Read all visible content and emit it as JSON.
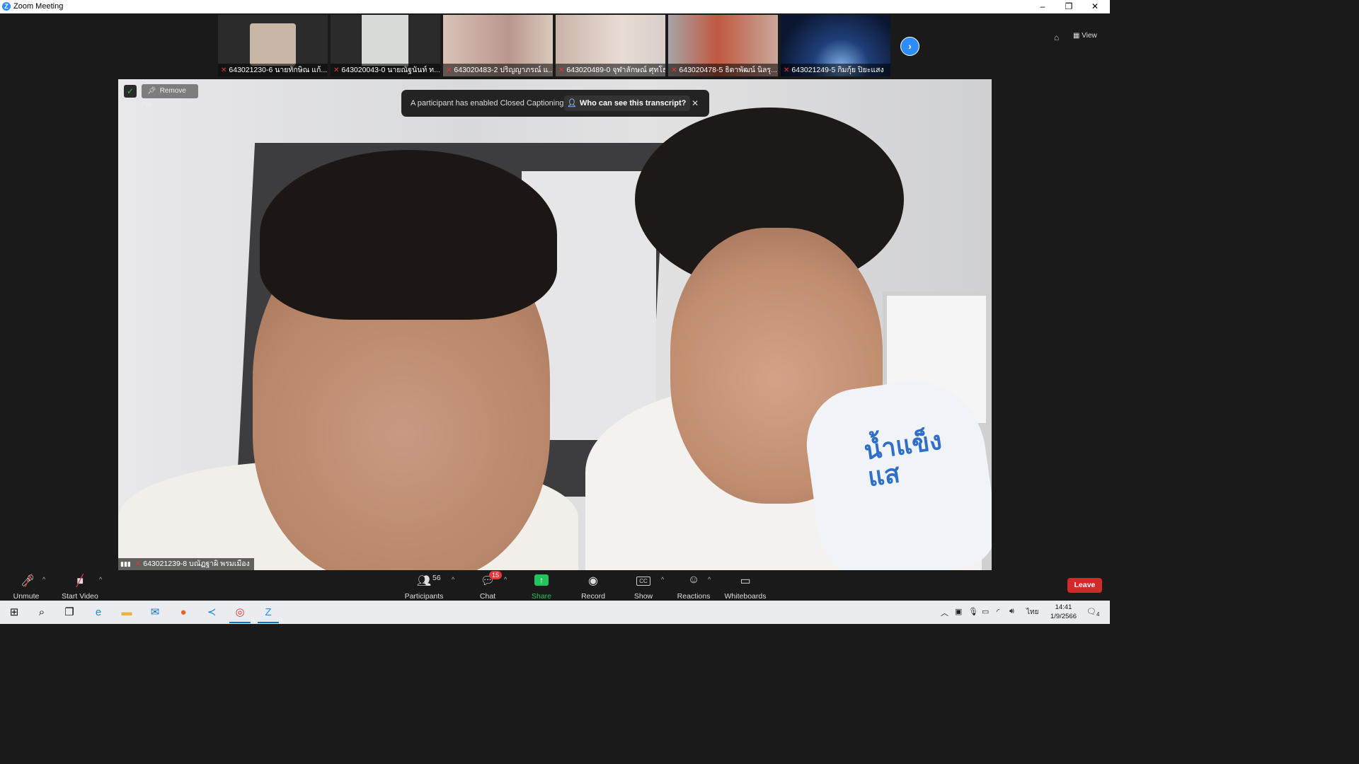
{
  "window": {
    "title": "Zoom Meeting",
    "minimize": "–",
    "restore": "❐",
    "close": "✕"
  },
  "strip": {
    "thumbnails": [
      {
        "name": "643021230-6 นายทักษิณ แก้..."
      },
      {
        "name": "643020043-0 นายณัฐนันท์ ท..."
      },
      {
        "name": "643020483-2 ปริญญาภรณ์ แ..."
      },
      {
        "name": "643020489-0 จุฬาลักษณ์ ศุทโธ"
      },
      {
        "name": "643020478-5 ธิดาพัฒน์ นิลรุ..."
      },
      {
        "name": "643021249-5 กิมกุ้ย ปิยะแสง"
      }
    ],
    "next_label": "›",
    "view_label": "View"
  },
  "video": {
    "remove_pin_label": "Remove Pin",
    "bottle_text": "น้ำแข็ง\nแส",
    "speaker_name": "643021239-8 บณัฏฐาผิ พรมเมือง"
  },
  "banner": {
    "message": "A participant has enabled Closed Captioning",
    "link": "Who can see this transcript?",
    "close": "✕"
  },
  "toolbar": {
    "unmute": "Unmute",
    "start_video": "Start Video",
    "participants": "Participants",
    "participants_count": "56",
    "chat": "Chat",
    "chat_badge": "15",
    "share_screen": "Share Screen",
    "record": "Record",
    "show_captions": "Show Captions",
    "reactions": "Reactions",
    "whiteboards": "Whiteboards",
    "leave": "Leave",
    "caret": "^"
  },
  "taskbar": {
    "time": "14:41",
    "date": "1/9/2566",
    "lang": "ไทย",
    "notifications": "4"
  },
  "colors": {
    "accent": "#2d8cff",
    "share_green": "#23c45e",
    "leave_red": "#d12a2a",
    "mute_red": "#e03a3a"
  }
}
